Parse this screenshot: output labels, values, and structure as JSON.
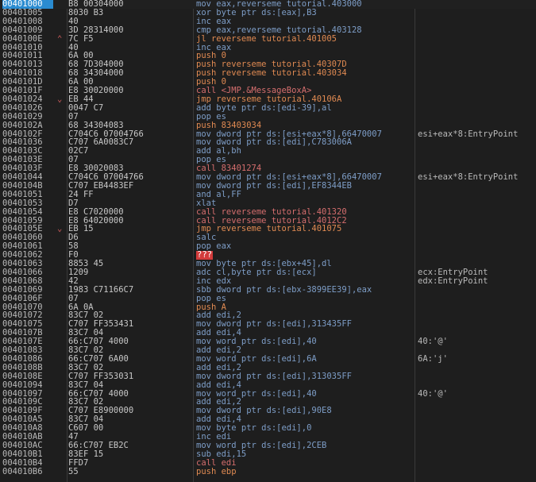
{
  "rows": [
    {
      "addr": "00401000",
      "hex": "B8 00304000",
      "asm": "mov eax,reverseme tutorial.403000",
      "comment": "",
      "arrow": "",
      "kind": "normal",
      "selected": true
    },
    {
      "addr": "00401005",
      "hex": "8030 B3",
      "asm": "xor byte ptr ds:[eax],B3",
      "comment": "",
      "arrow": "",
      "kind": "normal"
    },
    {
      "addr": "00401008",
      "hex": "40",
      "asm": "inc eax",
      "comment": "",
      "arrow": "",
      "kind": "normal"
    },
    {
      "addr": "00401009",
      "hex": "3D 28314000",
      "asm": "cmp eax,reverseme tutorial.403128",
      "comment": "",
      "arrow": "",
      "kind": "normal"
    },
    {
      "addr": "0040100E",
      "hex": "7C F5",
      "asm": "jl reverseme tutorial.401005",
      "comment": "",
      "arrow": "⌃",
      "kind": "jump"
    },
    {
      "addr": "00401010",
      "hex": "40",
      "asm": "inc eax",
      "comment": "",
      "arrow": "",
      "kind": "normal"
    },
    {
      "addr": "00401011",
      "hex": "6A 00",
      "asm": "push 0",
      "comment": "",
      "arrow": "",
      "kind": "push"
    },
    {
      "addr": "00401013",
      "hex": "68 7D304000",
      "asm": "push reverseme tutorial.40307D",
      "comment": "",
      "arrow": "",
      "kind": "push"
    },
    {
      "addr": "00401018",
      "hex": "68 34304000",
      "asm": "push reverseme tutorial.403034",
      "comment": "",
      "arrow": "",
      "kind": "push"
    },
    {
      "addr": "0040101D",
      "hex": "6A 00",
      "asm": "push 0",
      "comment": "",
      "arrow": "",
      "kind": "push"
    },
    {
      "addr": "0040101F",
      "hex": "E8 30020000",
      "asm": "call <JMP.&MessageBoxA>",
      "comment": "",
      "arrow": "",
      "kind": "call"
    },
    {
      "addr": "00401024",
      "hex": "EB 44",
      "asm": "jmp reverseme tutorial.40106A",
      "comment": "",
      "arrow": "⌄",
      "kind": "jump"
    },
    {
      "addr": "00401026",
      "hex": "0047 C7",
      "asm": "add byte ptr ds:[edi-39],al",
      "comment": "",
      "arrow": "",
      "kind": "normal"
    },
    {
      "addr": "00401029",
      "hex": "07",
      "asm": "pop es",
      "comment": "",
      "arrow": "",
      "kind": "normal"
    },
    {
      "addr": "0040102A",
      "hex": "68 34304083",
      "asm": "push 83403034",
      "comment": "",
      "arrow": "",
      "kind": "push"
    },
    {
      "addr": "0040102F",
      "hex": "C704C6 07004766",
      "asm": "mov dword ptr ds:[esi+eax*8],66470007",
      "comment": "esi+eax*8:EntryPoint",
      "arrow": "",
      "kind": "normal"
    },
    {
      "addr": "00401036",
      "hex": "C707 6A0083C7",
      "asm": "mov dword ptr ds:[edi],C783006A",
      "comment": "",
      "arrow": "",
      "kind": "normal"
    },
    {
      "addr": "0040103C",
      "hex": "02C7",
      "asm": "add al,bh",
      "comment": "",
      "arrow": "",
      "kind": "normal"
    },
    {
      "addr": "0040103E",
      "hex": "07",
      "asm": "pop es",
      "comment": "",
      "arrow": "",
      "kind": "normal"
    },
    {
      "addr": "0040103F",
      "hex": "E8 30020083",
      "asm": "call 83401274",
      "comment": "",
      "arrow": "",
      "kind": "call"
    },
    {
      "addr": "00401044",
      "hex": "C704C6 07004766",
      "asm": "mov dword ptr ds:[esi+eax*8],66470007",
      "comment": "esi+eax*8:EntryPoint",
      "arrow": "",
      "kind": "normal"
    },
    {
      "addr": "0040104B",
      "hex": "C707 EB4483EF",
      "asm": "mov dword ptr ds:[edi],EF8344EB",
      "comment": "",
      "arrow": "",
      "kind": "normal"
    },
    {
      "addr": "00401051",
      "hex": "24 FF",
      "asm": "and al,FF",
      "comment": "",
      "arrow": "",
      "kind": "normal"
    },
    {
      "addr": "00401053",
      "hex": "D7",
      "asm": "xlat",
      "comment": "",
      "arrow": "",
      "kind": "normal"
    },
    {
      "addr": "00401054",
      "hex": "E8 C7020000",
      "asm": "call reverseme tutorial.401320",
      "comment": "",
      "arrow": "",
      "kind": "call"
    },
    {
      "addr": "00401059",
      "hex": "E8 64020000",
      "asm": "call reverseme tutorial.4012C2",
      "comment": "",
      "arrow": "",
      "kind": "call"
    },
    {
      "addr": "0040105E",
      "hex": "EB 15",
      "asm": "jmp reverseme tutorial.401075",
      "comment": "",
      "arrow": "⌄",
      "kind": "jump"
    },
    {
      "addr": "00401060",
      "hex": "D6",
      "asm": "salc",
      "comment": "",
      "arrow": "",
      "kind": "normal"
    },
    {
      "addr": "00401061",
      "hex": "58",
      "asm": "pop eax",
      "comment": "",
      "arrow": "",
      "kind": "normal"
    },
    {
      "addr": "00401062",
      "hex": "F0",
      "asm": "???",
      "comment": "",
      "arrow": "",
      "kind": "bad"
    },
    {
      "addr": "00401063",
      "hex": "8853 45",
      "asm": "mov byte ptr ds:[ebx+45],dl",
      "comment": "",
      "arrow": "",
      "kind": "normal"
    },
    {
      "addr": "00401066",
      "hex": "1209",
      "asm": "adc cl,byte ptr ds:[ecx]",
      "comment": "ecx:EntryPoint",
      "arrow": "",
      "kind": "normal"
    },
    {
      "addr": "00401068",
      "hex": "42",
      "asm": "inc edx",
      "comment": "edx:EntryPoint",
      "arrow": "",
      "kind": "normal"
    },
    {
      "addr": "00401069",
      "hex": "1983 C71166C7",
      "asm": "sbb dword ptr ds:[ebx-3899EE39],eax",
      "comment": "",
      "arrow": "",
      "kind": "normal"
    },
    {
      "addr": "0040106F",
      "hex": "07",
      "asm": "pop es",
      "comment": "",
      "arrow": "",
      "kind": "normal"
    },
    {
      "addr": "00401070",
      "hex": "6A 0A",
      "asm": "push A",
      "comment": "",
      "arrow": "",
      "kind": "push"
    },
    {
      "addr": "00401072",
      "hex": "83C7 02",
      "asm": "add edi,2",
      "comment": "",
      "arrow": "",
      "kind": "normal"
    },
    {
      "addr": "00401075",
      "hex": "C707 FF353431",
      "asm": "mov dword ptr ds:[edi],313435FF",
      "comment": "",
      "arrow": "",
      "kind": "normal"
    },
    {
      "addr": "0040107B",
      "hex": "83C7 04",
      "asm": "add edi,4",
      "comment": "",
      "arrow": "",
      "kind": "normal"
    },
    {
      "addr": "0040107E",
      "hex": "66:C707 4000",
      "asm": "mov word ptr ds:[edi],40",
      "comment": "40:'@'",
      "arrow": "",
      "kind": "normal"
    },
    {
      "addr": "00401083",
      "hex": "83C7 02",
      "asm": "add edi,2",
      "comment": "",
      "arrow": "",
      "kind": "normal"
    },
    {
      "addr": "00401086",
      "hex": "66:C707 6A00",
      "asm": "mov word ptr ds:[edi],6A",
      "comment": "6A:'j'",
      "arrow": "",
      "kind": "normal"
    },
    {
      "addr": "0040108B",
      "hex": "83C7 02",
      "asm": "add edi,2",
      "comment": "",
      "arrow": "",
      "kind": "normal"
    },
    {
      "addr": "0040108E",
      "hex": "C707 FF353031",
      "asm": "mov dword ptr ds:[edi],313035FF",
      "comment": "",
      "arrow": "",
      "kind": "normal"
    },
    {
      "addr": "00401094",
      "hex": "83C7 04",
      "asm": "add edi,4",
      "comment": "",
      "arrow": "",
      "kind": "normal"
    },
    {
      "addr": "00401097",
      "hex": "66:C707 4000",
      "asm": "mov word ptr ds:[edi],40",
      "comment": "40:'@'",
      "arrow": "",
      "kind": "normal"
    },
    {
      "addr": "0040109C",
      "hex": "83C7 02",
      "asm": "add edi,2",
      "comment": "",
      "arrow": "",
      "kind": "normal"
    },
    {
      "addr": "0040109F",
      "hex": "C707 E8900000",
      "asm": "mov dword ptr ds:[edi],90E8",
      "comment": "",
      "arrow": "",
      "kind": "normal"
    },
    {
      "addr": "004010A5",
      "hex": "83C7 04",
      "asm": "add edi,4",
      "comment": "",
      "arrow": "",
      "kind": "normal"
    },
    {
      "addr": "004010A8",
      "hex": "C607 00",
      "asm": "mov byte ptr ds:[edi],0",
      "comment": "",
      "arrow": "",
      "kind": "normal"
    },
    {
      "addr": "004010AB",
      "hex": "47",
      "asm": "inc edi",
      "comment": "",
      "arrow": "",
      "kind": "normal"
    },
    {
      "addr": "004010AC",
      "hex": "66:C707 EB2C",
      "asm": "mov word ptr ds:[edi],2CEB",
      "comment": "",
      "arrow": "",
      "kind": "normal"
    },
    {
      "addr": "004010B1",
      "hex": "83EF 15",
      "asm": "sub edi,15",
      "comment": "",
      "arrow": "",
      "kind": "normal"
    },
    {
      "addr": "004010B4",
      "hex": "FFD7",
      "asm": "call edi",
      "comment": "",
      "arrow": "",
      "kind": "call"
    },
    {
      "addr": "004010B6",
      "hex": "55",
      "asm": "push ebp",
      "comment": "",
      "arrow": "",
      "kind": "push"
    }
  ],
  "colors": {
    "background": "#1e1e1e",
    "selection": "#2a8bd0",
    "mnemonic": "#7e9ec8",
    "call": "#d56e6e",
    "jump": "#e08a52",
    "invalid": "#d33b3b"
  }
}
